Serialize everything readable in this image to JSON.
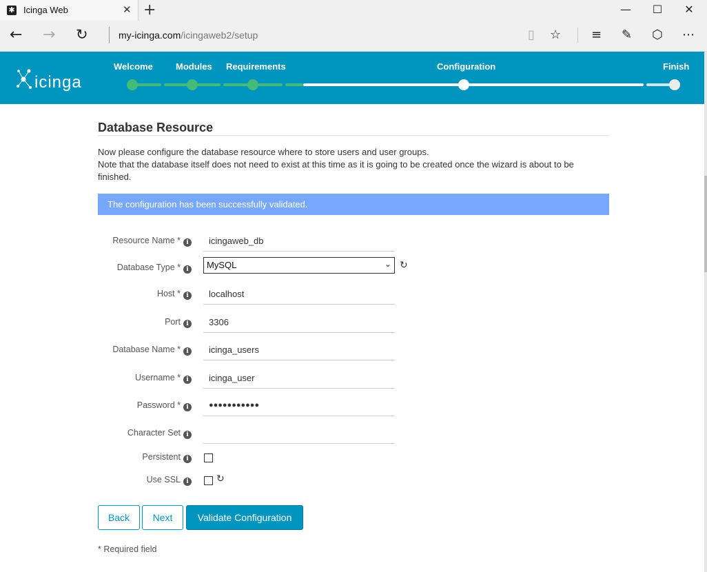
{
  "browser": {
    "tab_title": "Icinga Web",
    "tab_close": "✕",
    "new_tab": "+",
    "window_minimize": "—",
    "window_maximize": "☐",
    "window_close": "✕",
    "url_host": "my-icinga.com",
    "url_path": "/icingaweb2/setup"
  },
  "header": {
    "logo_text": "icinga",
    "steps": [
      {
        "label": "Welcome",
        "state": "done"
      },
      {
        "label": "Modules",
        "state": "done"
      },
      {
        "label": "Requirements",
        "state": "done"
      },
      {
        "label": "Configuration",
        "state": "current"
      },
      {
        "label": "Finish",
        "state": "todo"
      }
    ],
    "colors": {
      "bar": "#0095bf",
      "done": "#44bb77",
      "track": "#ffffff"
    }
  },
  "main": {
    "title": "Database Resource",
    "intro_line1": "Now please configure the database resource where to store users and user groups.",
    "intro_line2": "Note that the database itself does not need to exist at this time as it is going to be created once the wizard is about to be finished.",
    "alert": "The configuration has been successfully validated.",
    "form": {
      "resource_name": {
        "label": "Resource Name *",
        "value": "icingaweb_db"
      },
      "database_type": {
        "label": "Database Type *",
        "value": "MySQL"
      },
      "host": {
        "label": "Host *",
        "value": "localhost"
      },
      "port": {
        "label": "Port",
        "value": "3306"
      },
      "database_name": {
        "label": "Database Name *",
        "value": "icinga_users"
      },
      "username": {
        "label": "Username *",
        "value": "icinga_user"
      },
      "password": {
        "label": "Password *",
        "value": "●●●●●●●●●●●"
      },
      "charset": {
        "label": "Character Set",
        "value": ""
      },
      "persistent": {
        "label": "Persistent",
        "checked": false
      },
      "use_ssl": {
        "label": "Use SSL",
        "checked": false
      }
    },
    "buttons": {
      "back": "Back",
      "next": "Next",
      "validate": "Validate Configuration"
    },
    "required_note": "* Required field"
  }
}
